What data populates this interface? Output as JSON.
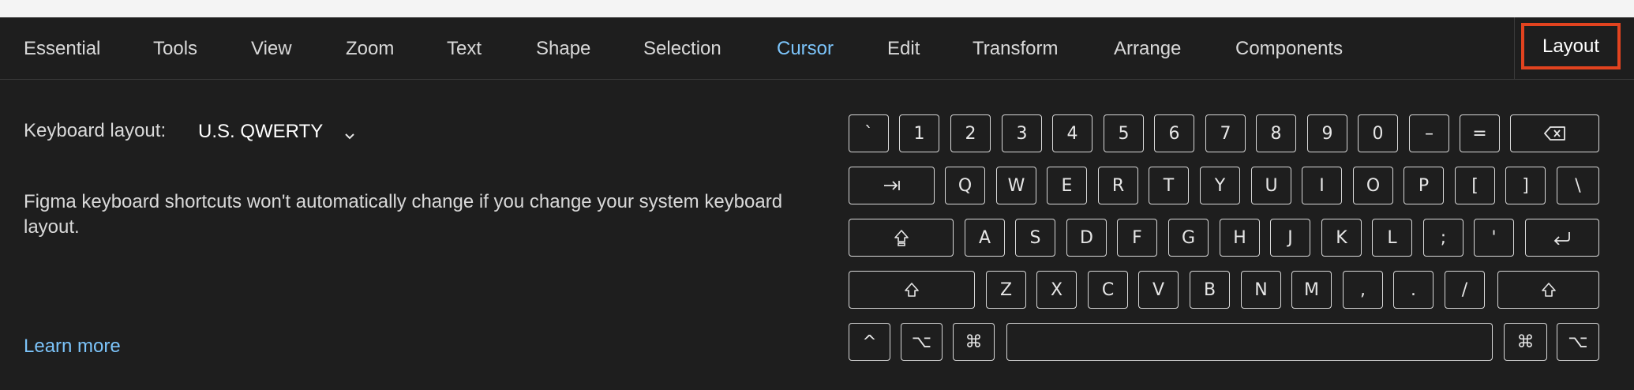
{
  "tabs": [
    {
      "label": "Essential",
      "name": "tab-essential",
      "active": false
    },
    {
      "label": "Tools",
      "name": "tab-tools",
      "active": false
    },
    {
      "label": "View",
      "name": "tab-view",
      "active": false
    },
    {
      "label": "Zoom",
      "name": "tab-zoom",
      "active": false
    },
    {
      "label": "Text",
      "name": "tab-text",
      "active": false
    },
    {
      "label": "Shape",
      "name": "tab-shape",
      "active": false
    },
    {
      "label": "Selection",
      "name": "tab-selection",
      "active": false
    },
    {
      "label": "Cursor",
      "name": "tab-cursor",
      "active": true
    },
    {
      "label": "Edit",
      "name": "tab-edit",
      "active": false
    },
    {
      "label": "Transform",
      "name": "tab-transform",
      "active": false
    },
    {
      "label": "Arrange",
      "name": "tab-arrange",
      "active": false
    },
    {
      "label": "Components",
      "name": "tab-components",
      "active": false
    }
  ],
  "layout_tab": {
    "label": "Layout"
  },
  "keyboard": {
    "label": "Keyboard layout:",
    "selected": "U.S. QWERTY",
    "notice": "Figma keyboard shortcuts won't automatically change if you change your system keyboard layout.",
    "learn_more": "Learn more"
  },
  "keys": {
    "row1": [
      "`",
      "1",
      "2",
      "3",
      "4",
      "5",
      "6",
      "7",
      "8",
      "9",
      "0",
      "–",
      "=",
      "backspace-icon"
    ],
    "row2": [
      "tab-icon",
      "Q",
      "W",
      "E",
      "R",
      "T",
      "Y",
      "U",
      "I",
      "O",
      "P",
      "[",
      "]",
      "\\"
    ],
    "row3": [
      "caps-lock-icon",
      "A",
      "S",
      "D",
      "F",
      "G",
      "H",
      "J",
      "K",
      "L",
      ";",
      "'",
      "return-icon"
    ],
    "row4": [
      "shift-icon",
      "Z",
      "X",
      "C",
      "V",
      "B",
      "N",
      "M",
      ",",
      ".",
      "/",
      "shift-icon"
    ],
    "row5": [
      "^",
      "⌥",
      "⌘",
      "",
      "⌘",
      "⌥"
    ]
  },
  "colors": {
    "accent": "#7cc4fa",
    "highlight_box": "#e2431f",
    "background": "#1e1e1e"
  }
}
